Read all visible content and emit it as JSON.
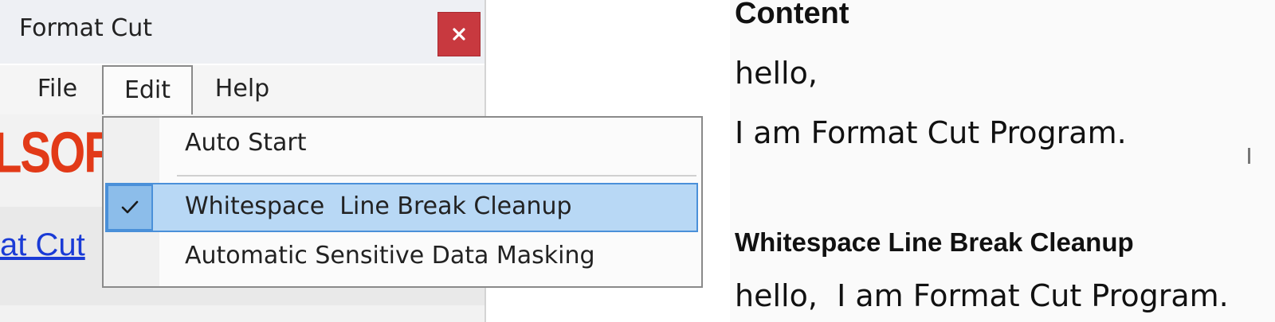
{
  "window": {
    "title": "Format Cut",
    "close_symbol": "×"
  },
  "menu": {
    "file": "File",
    "edit": "Edit",
    "help": "Help"
  },
  "edit_menu": {
    "items": [
      {
        "label": "Auto Start",
        "checked": false
      },
      {
        "label": "Whitespace  Line Break Cleanup",
        "checked": true,
        "highlighted": true
      },
      {
        "label": "Automatic Sensitive Data Masking",
        "checked": false
      }
    ]
  },
  "background": {
    "logo_fragment": "LSOFT.co",
    "link_fragment": "at Cut"
  },
  "document": {
    "heading": "Content",
    "line1": "hello,",
    "line2": "I am Format Cut Program.",
    "heading2": "Whitespace Line Break Cleanup",
    "result": "hello,  I am Format Cut Program."
  },
  "colors": {
    "close_button": "#c8393f",
    "highlight": "#b8d8f5",
    "highlight_border": "#4a90d9",
    "logo": "#e23a18",
    "link": "#1a3bd6"
  }
}
